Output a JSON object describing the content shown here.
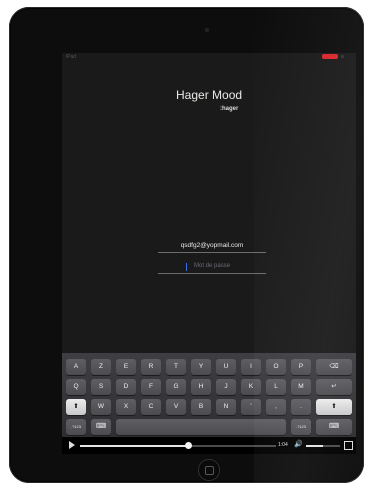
{
  "status_bar": {
    "carrier": "iPad",
    "battery_color": "#d9262b"
  },
  "app": {
    "title": "Hager Mood",
    "brand": ":hager"
  },
  "login": {
    "email_value": "qsdfg2@yopmail.com",
    "password_placeholder": "Mot de passe"
  },
  "keyboard": {
    "row1": [
      "A",
      "Z",
      "E",
      "R",
      "T",
      "Y",
      "U",
      "I",
      "O",
      "P"
    ],
    "row1_delete": "⌫",
    "row2": [
      "Q",
      "S",
      "D",
      "F",
      "G",
      "H",
      "J",
      "K",
      "L",
      "M"
    ],
    "row2_return": "↵",
    "row3": [
      "W",
      "X",
      "C",
      "V",
      "B",
      "N",
      "'",
      ",",
      "."
    ],
    "shift": "⬆",
    "row4_left": ".?123",
    "row4_space": "",
    "row4_right": ".?123",
    "row4_hide": "⌨"
  },
  "video_player": {
    "time": "1:04",
    "progress": 0.55,
    "volume": 0.5,
    "volume_icon": "speaker-icon",
    "play_icon": "play-icon"
  }
}
